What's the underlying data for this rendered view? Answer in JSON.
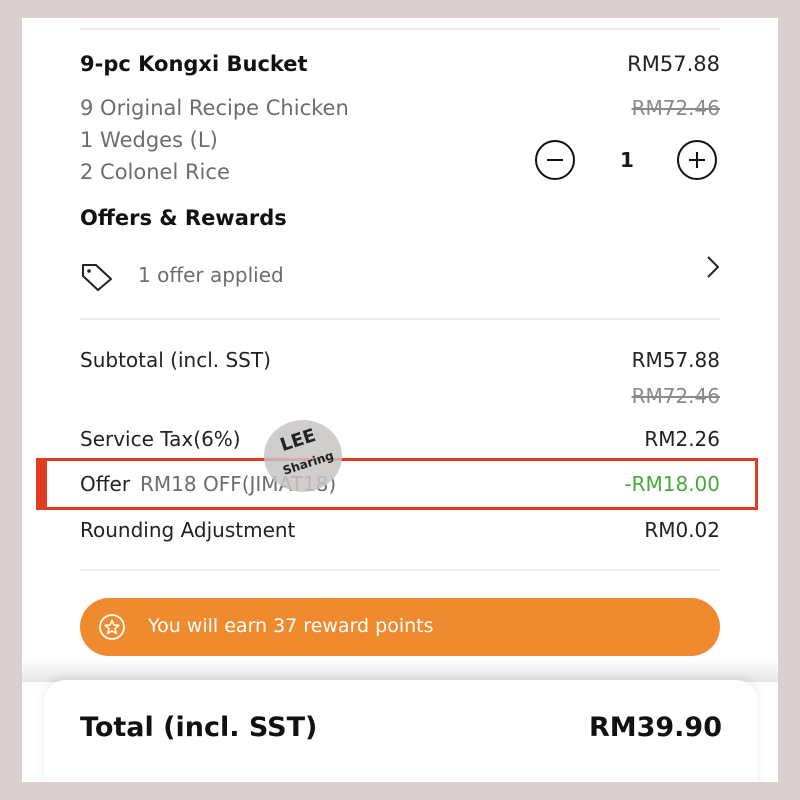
{
  "item": {
    "name": "9-pc Kongxi Bucket",
    "price": "RM57.88",
    "original_price": "RM72.46",
    "description": [
      "9 Original Recipe Chicken",
      "1 Wedges (L)",
      "2 Colonel Rice"
    ],
    "quantity": "1"
  },
  "offers": {
    "title": "Offers & Rewards",
    "applied_text": "1 offer applied",
    "icon": "tag-icon"
  },
  "summary": {
    "subtotal_label": "Subtotal (incl. SST)",
    "subtotal_value": "RM57.88",
    "subtotal_original": "RM72.46",
    "service_tax_label": "Service Tax(6%)",
    "service_tax_value": "RM2.26",
    "offer_label": "Offer",
    "offer_code": "RM18 OFF(JIMAT18)",
    "offer_value": "-RM18.00",
    "rounding_label": "Rounding Adjustment",
    "rounding_value": "RM0.02"
  },
  "reward": {
    "text": "You will earn 37 reward points",
    "icon": "star-icon",
    "color": "#f08a2f"
  },
  "total": {
    "label": "Total (incl. SST)",
    "value": "RM39.90"
  },
  "watermark": {
    "line1": "LEE",
    "line2": "Sharing"
  },
  "colors": {
    "highlight": "#e23b22",
    "discount": "#49a83a",
    "muted": "#6d6d6d"
  }
}
